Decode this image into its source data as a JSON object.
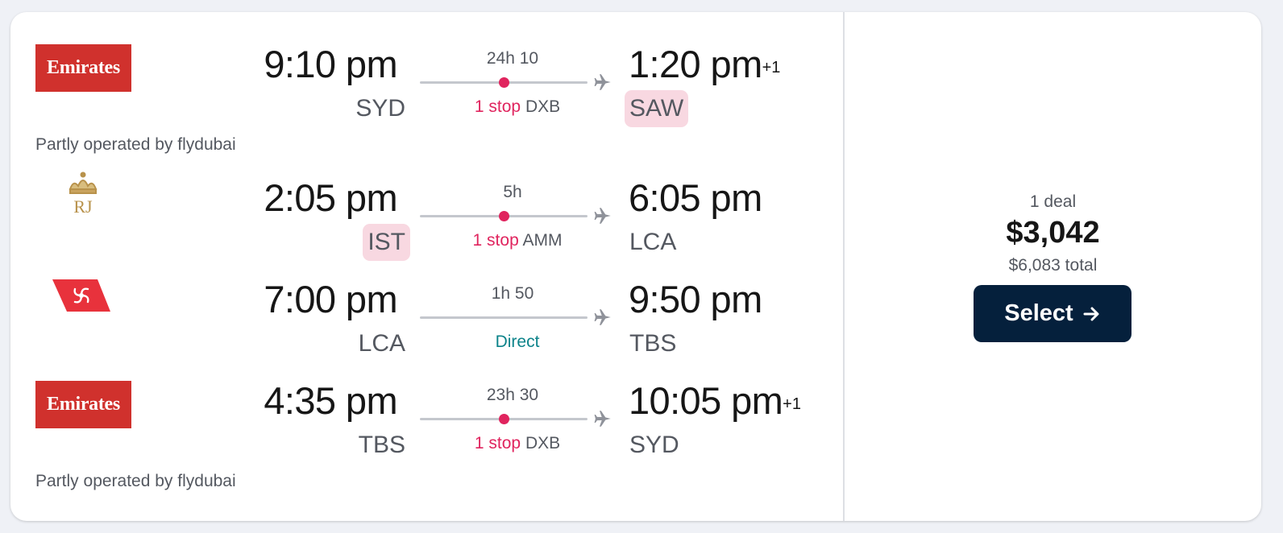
{
  "legs": [
    {
      "airline": "Emirates",
      "logo_icon": "emirates-logo",
      "dep_time": "9:10 pm",
      "dep_code": "SYD",
      "dep_highlight": false,
      "duration": "24h 10",
      "stops": "1 stop",
      "via": "DXB",
      "arr_time": "1:20 pm",
      "arr_plus": "+1",
      "arr_code": "SAW",
      "arr_highlight": true,
      "operated_by": "Partly operated by flydubai"
    },
    {
      "airline": "Royal Jordanian",
      "logo_icon": "royal-jordanian-logo",
      "dep_time": "2:05 pm",
      "dep_code": "IST",
      "dep_highlight": true,
      "duration": "5h",
      "stops": "1 stop",
      "via": "AMM",
      "arr_time": "6:05 pm",
      "arr_code": "LCA",
      "arr_highlight": false
    },
    {
      "airline": "Georgian Airways",
      "logo_icon": "georgian-airways-logo",
      "dep_time": "7:00 pm",
      "dep_code": "LCA",
      "dep_highlight": false,
      "duration": "1h 50",
      "stops": "Direct",
      "arr_time": "9:50 pm",
      "arr_code": "TBS",
      "arr_highlight": false
    },
    {
      "airline": "Emirates",
      "logo_icon": "emirates-logo",
      "dep_time": "4:35 pm",
      "dep_code": "TBS",
      "dep_highlight": false,
      "duration": "23h 30",
      "stops": "1 stop",
      "via": "DXB",
      "arr_time": "10:05 pm",
      "arr_plus": "+1",
      "arr_code": "SYD",
      "arr_highlight": false,
      "operated_by": "Partly operated by flydubai"
    }
  ],
  "price": {
    "deal_count": "1 deal",
    "amount": "$3,042",
    "total": "$6,083 total",
    "select_label": "Select"
  },
  "colors": {
    "stop_accent": "#e0245e",
    "direct": "#0c838a",
    "highlight_bg": "#f8d8e1",
    "button_bg": "#05203c",
    "emirates_red": "#d0312d"
  }
}
